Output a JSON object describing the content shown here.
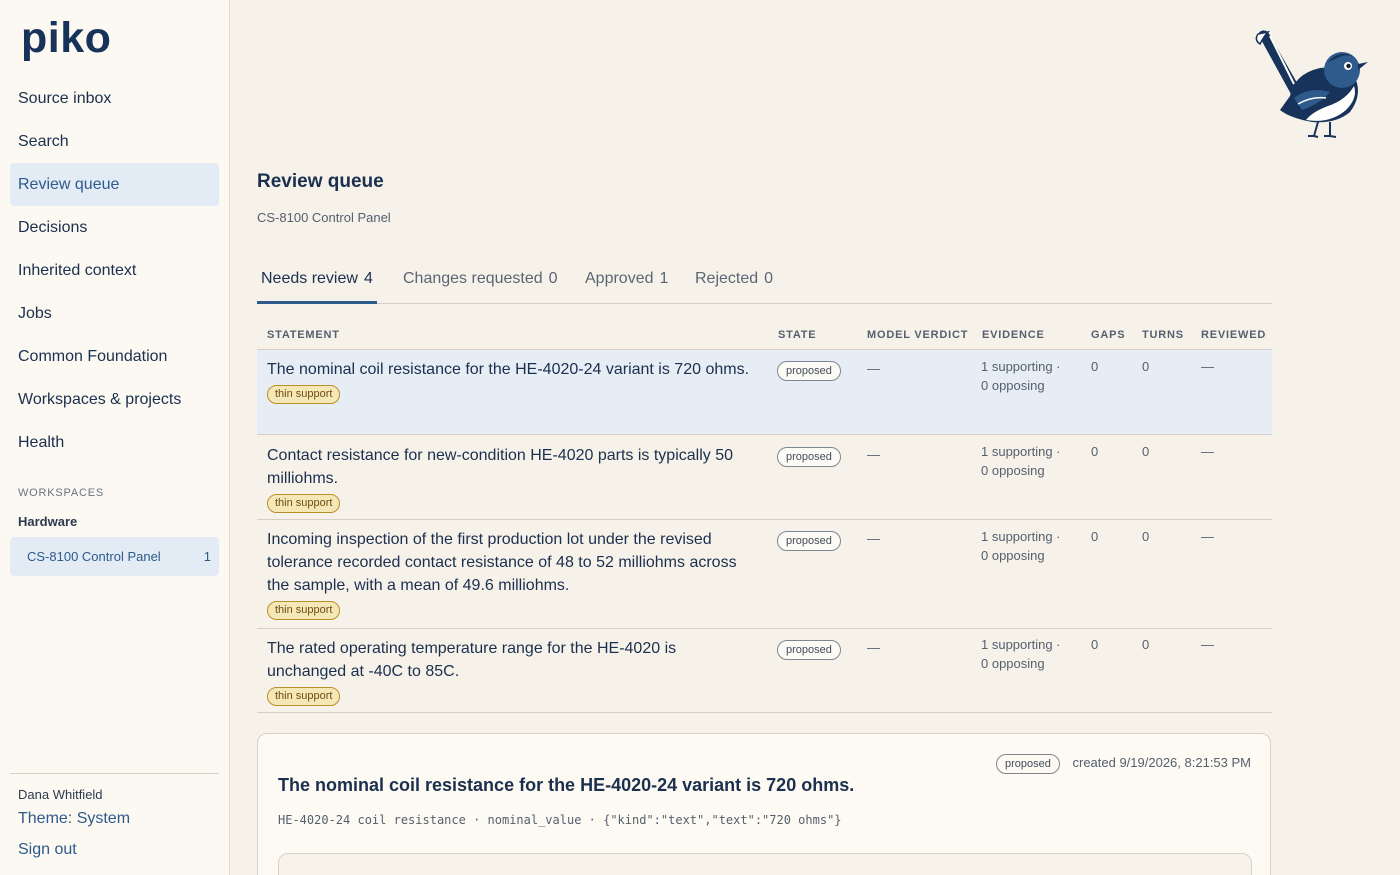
{
  "app": {
    "logo": "piko"
  },
  "sidebar": {
    "items": [
      {
        "label": "Source inbox"
      },
      {
        "label": "Search"
      },
      {
        "label": "Review queue"
      },
      {
        "label": "Decisions"
      },
      {
        "label": "Inherited context"
      },
      {
        "label": "Jobs"
      },
      {
        "label": "Common Foundation"
      },
      {
        "label": "Workspaces & projects"
      },
      {
        "label": "Health"
      }
    ],
    "active_index": 2,
    "workspaces_heading": "WORKSPACES",
    "workspace_group": "Hardware",
    "workspace_item": {
      "label": "CS-8100 Control Panel",
      "count": "1"
    },
    "user_name": "Dana Whitfield",
    "theme_label": "Theme: System",
    "signout_label": "Sign out"
  },
  "header": {
    "title": "Review queue",
    "subtitle": "CS-8100 Control Panel"
  },
  "tabs": [
    {
      "label": "Needs review",
      "count": "4",
      "active": true
    },
    {
      "label": "Changes requested",
      "count": "0",
      "active": false
    },
    {
      "label": "Approved",
      "count": "1",
      "active": false
    },
    {
      "label": "Rejected",
      "count": "0",
      "active": false
    }
  ],
  "table": {
    "columns": [
      "STATEMENT",
      "STATE",
      "MODEL VERDICT",
      "EVIDENCE",
      "GAPS",
      "TURNS",
      "REVIEWED"
    ],
    "rows": [
      {
        "statement": "The nominal coil resistance for the HE-4020-24 variant is 720 ohms.",
        "badge": "thin support",
        "state": "proposed",
        "verdict": "—",
        "evidence_supporting": "1 supporting ·",
        "evidence_opposing": "0 opposing",
        "gaps": "0",
        "turns": "0",
        "reviewed": "—"
      },
      {
        "statement": "Contact resistance for new-condition HE-4020 parts is typically 50 milliohms.",
        "badge": "thin support",
        "state": "proposed",
        "verdict": "—",
        "evidence_supporting": "1 supporting ·",
        "evidence_opposing": "0 opposing",
        "gaps": "0",
        "turns": "0",
        "reviewed": "—"
      },
      {
        "statement": "Incoming inspection of the first production lot under the revised tolerance recorded contact resistance of 48 to 52 milliohms across the sample, with a mean of 49.6 milliohms.",
        "badge": "thin support",
        "state": "proposed",
        "verdict": "—",
        "evidence_supporting": "1 supporting ·",
        "evidence_opposing": "0 opposing",
        "gaps": "0",
        "turns": "0",
        "reviewed": "—"
      },
      {
        "statement": "The rated operating temperature range for the HE-4020 is unchanged at -40C to 85C.",
        "badge": "thin support",
        "state": "proposed",
        "verdict": "—",
        "evidence_supporting": "1 supporting ·",
        "evidence_opposing": "0 opposing",
        "gaps": "0",
        "turns": "0",
        "reviewed": "—"
      }
    ]
  },
  "detail": {
    "state": "proposed",
    "created": "created 9/19/2026, 8:21:53 PM",
    "title": "The nominal coil resistance for the HE-4020-24 variant is 720 ohms.",
    "meta": "HE-4020-24 coil resistance · nominal_value · {\"kind\":\"text\",\"text\":\"720 ohms\"}"
  },
  "colors": {
    "accent": "#2e5a8c",
    "navy": "#1b2f4e",
    "selected_row": "#e6edf5",
    "badge_bg": "#f6e7b6",
    "page_bg": "#f6f2ea"
  }
}
